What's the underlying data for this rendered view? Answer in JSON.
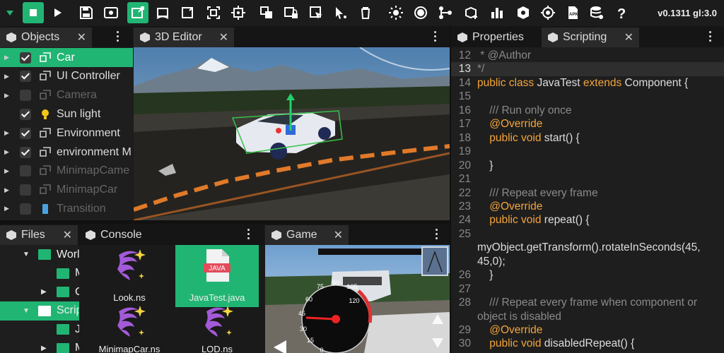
{
  "toolbar": {
    "version": "v0.1311 gl:3.0",
    "buttons": [
      "dropdown-arrow",
      "stop",
      "play",
      "save",
      "view",
      "move-tool",
      "rotate-tool",
      "scale-tool",
      "fit-tool",
      "target-tool",
      "group-tool",
      "lock-tool",
      "select-tool",
      "pointer-tool",
      "delete",
      "sun",
      "sphere",
      "nodes",
      "add-object",
      "chart",
      "cube-settings",
      "crosshair",
      "apk",
      "database-settings",
      "help"
    ]
  },
  "objects": {
    "tab_label": "Objects",
    "items": [
      {
        "label": "Car",
        "checked": true,
        "selected": true,
        "dim": false,
        "arrow": true,
        "icon": "object-icon"
      },
      {
        "label": "UI Controller",
        "checked": true,
        "selected": false,
        "dim": false,
        "arrow": true,
        "icon": "object-icon"
      },
      {
        "label": "Camera",
        "checked": false,
        "selected": false,
        "dim": true,
        "arrow": true,
        "icon": "object-icon"
      },
      {
        "label": "Sun light",
        "checked": true,
        "selected": false,
        "dim": false,
        "arrow": false,
        "icon": "bulb-icon"
      },
      {
        "label": "Environment",
        "checked": true,
        "selected": false,
        "dim": false,
        "arrow": true,
        "icon": "object-icon"
      },
      {
        "label": "environment M",
        "checked": true,
        "selected": false,
        "dim": false,
        "arrow": true,
        "icon": "object-icon"
      },
      {
        "label": "MinimapCame",
        "checked": false,
        "selected": false,
        "dim": true,
        "arrow": true,
        "icon": "object-icon"
      },
      {
        "label": "MinimapCar",
        "checked": false,
        "selected": false,
        "dim": true,
        "arrow": true,
        "icon": "object-icon"
      },
      {
        "label": "Transition",
        "checked": false,
        "selected": false,
        "dim": true,
        "arrow": true,
        "icon": "phone-icon"
      }
    ]
  },
  "editor": {
    "tab_label": "3D Editor"
  },
  "right": {
    "tab_properties": "Properties",
    "tab_scripting": "Scripting"
  },
  "files": {
    "tab_label": "Files",
    "tree": [
      {
        "label": "World",
        "indent": 1,
        "arrow": "▼",
        "selected": false
      },
      {
        "label": "Me",
        "indent": 2,
        "arrow": "",
        "selected": false
      },
      {
        "label": "Ca",
        "indent": 2,
        "arrow": "▶",
        "selected": false
      },
      {
        "label": "Scripts",
        "indent": 1,
        "arrow": "▼",
        "selected": true
      },
      {
        "label": "Ja",
        "indent": 2,
        "arrow": "",
        "selected": false
      },
      {
        "label": "Me",
        "indent": 2,
        "arrow": "▶",
        "selected": false
      }
    ],
    "assets": [
      {
        "label": "Look.ns",
        "kind": "node-script",
        "selected": false
      },
      {
        "label": "JavaTest.java",
        "kind": "java",
        "selected": true,
        "badge": "JAVA"
      },
      {
        "label": "MinimapCar.ns",
        "kind": "node-script",
        "selected": false
      },
      {
        "label": "LOD.ns",
        "kind": "node-script",
        "selected": false
      }
    ]
  },
  "console": {
    "tab_label": "Console"
  },
  "game": {
    "tab_label": "Game",
    "speedo_labels": [
      "60",
      "75",
      "90",
      "105",
      "45",
      "120",
      "30",
      "15",
      "0"
    ]
  },
  "code": {
    "current_line": "13",
    "lines": [
      {
        "n": "12",
        "parts": [
          {
            "t": " * @Author",
            "c": "cm"
          }
        ]
      },
      {
        "n": "13",
        "parts": [
          {
            "t": "*/",
            "c": "cm"
          }
        ]
      },
      {
        "n": "14",
        "parts": [
          {
            "t": "public class ",
            "c": "kw"
          },
          {
            "t": "JavaTest ",
            "c": ""
          },
          {
            "t": "extends ",
            "c": "kw"
          },
          {
            "t": "Component {",
            "c": ""
          }
        ]
      },
      {
        "n": "15",
        "parts": []
      },
      {
        "n": "16",
        "parts": [
          {
            "t": "    /// Run only once",
            "c": "cm"
          }
        ]
      },
      {
        "n": "17",
        "parts": [
          {
            "t": "    @Override",
            "c": "an"
          }
        ]
      },
      {
        "n": "18",
        "parts": [
          {
            "t": "    public void ",
            "c": "kw"
          },
          {
            "t": "start() {",
            "c": ""
          }
        ]
      },
      {
        "n": "19",
        "parts": []
      },
      {
        "n": "20",
        "parts": [
          {
            "t": "    }",
            "c": ""
          }
        ]
      },
      {
        "n": "21",
        "parts": []
      },
      {
        "n": "22",
        "parts": [
          {
            "t": "    /// Repeat every frame",
            "c": "cm"
          }
        ]
      },
      {
        "n": "23",
        "parts": [
          {
            "t": "    @Override",
            "c": "an"
          }
        ]
      },
      {
        "n": "24",
        "parts": [
          {
            "t": "    public void ",
            "c": "kw"
          },
          {
            "t": "repeat() {",
            "c": ""
          }
        ]
      },
      {
        "n": "25",
        "parts": []
      },
      {
        "n": "",
        "parts": [
          {
            "t": "myObject.getTransform().rotateInSeconds(45,",
            "c": ""
          }
        ]
      },
      {
        "n": "",
        "parts": [
          {
            "t": "45,0);",
            "c": ""
          }
        ]
      },
      {
        "n": "26",
        "parts": [
          {
            "t": "    }",
            "c": ""
          }
        ]
      },
      {
        "n": "27",
        "parts": []
      },
      {
        "n": "28",
        "parts": [
          {
            "t": "    /// Repeat every frame when component or",
            "c": "cm"
          }
        ]
      },
      {
        "n": "",
        "parts": [
          {
            "t": "object is disabled",
            "c": "cm"
          }
        ]
      },
      {
        "n": "29",
        "parts": [
          {
            "t": "    @Override",
            "c": "an"
          }
        ]
      },
      {
        "n": "30",
        "parts": [
          {
            "t": "    public void ",
            "c": "kw"
          },
          {
            "t": "disabledRepeat() {",
            "c": ""
          }
        ]
      }
    ]
  },
  "colors": {
    "accent": "#21b573",
    "keyword": "#f3a53a",
    "comment": "#8a8a8a"
  }
}
